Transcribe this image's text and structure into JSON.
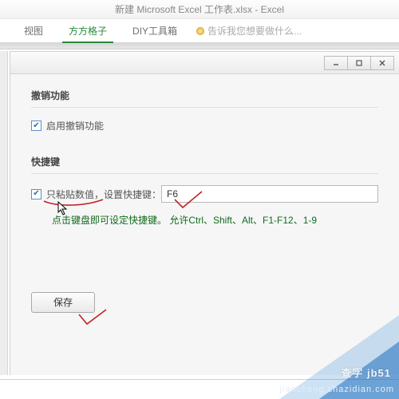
{
  "app": {
    "title": "新建 Microsoft Excel 工作表.xlsx - Excel"
  },
  "ribbon": {
    "tabs": [
      {
        "label": "视图"
      },
      {
        "label": "方方格子"
      },
      {
        "label": "DIY工具箱"
      }
    ],
    "tellme": "告诉我您想要做什么..."
  },
  "dialog": {
    "sections": {
      "undo": {
        "title": "撤销功能",
        "enable_undo_label": "启用撤销功能",
        "enable_undo_checked": true
      },
      "shortcut": {
        "title": "快捷键",
        "paste_values_label": "只粘贴数值，设置快捷键：",
        "paste_values_checked": true,
        "shortcut_value": "F6",
        "hint": "点击键盘即可设定快捷键。  允许Ctrl、Shift、Alt、F1-F12、1-9"
      }
    },
    "save_label": "保存"
  },
  "watermark": {
    "line1": "查字 jb51",
    "line2": "jiaocheng.chazidian.com"
  }
}
